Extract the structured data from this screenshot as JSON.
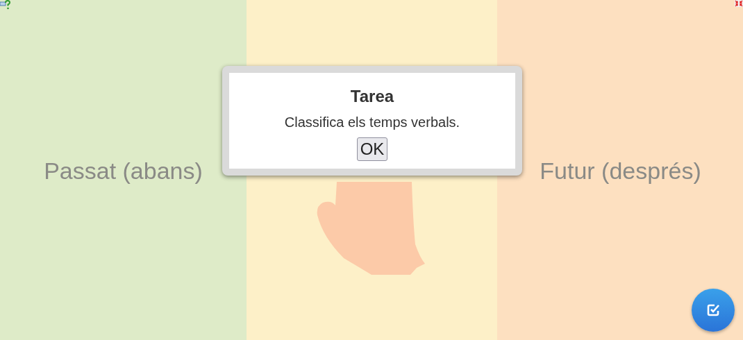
{
  "columns": [
    {
      "label": "Passat (abans)",
      "color": "#deebc8"
    },
    {
      "color": "#fdf0c8"
    },
    {
      "label": "Futur (després)",
      "color": "#fde0c0"
    }
  ],
  "dialog": {
    "title": "Tarea",
    "message": "Classifica els temps verbals.",
    "button": "OK"
  }
}
